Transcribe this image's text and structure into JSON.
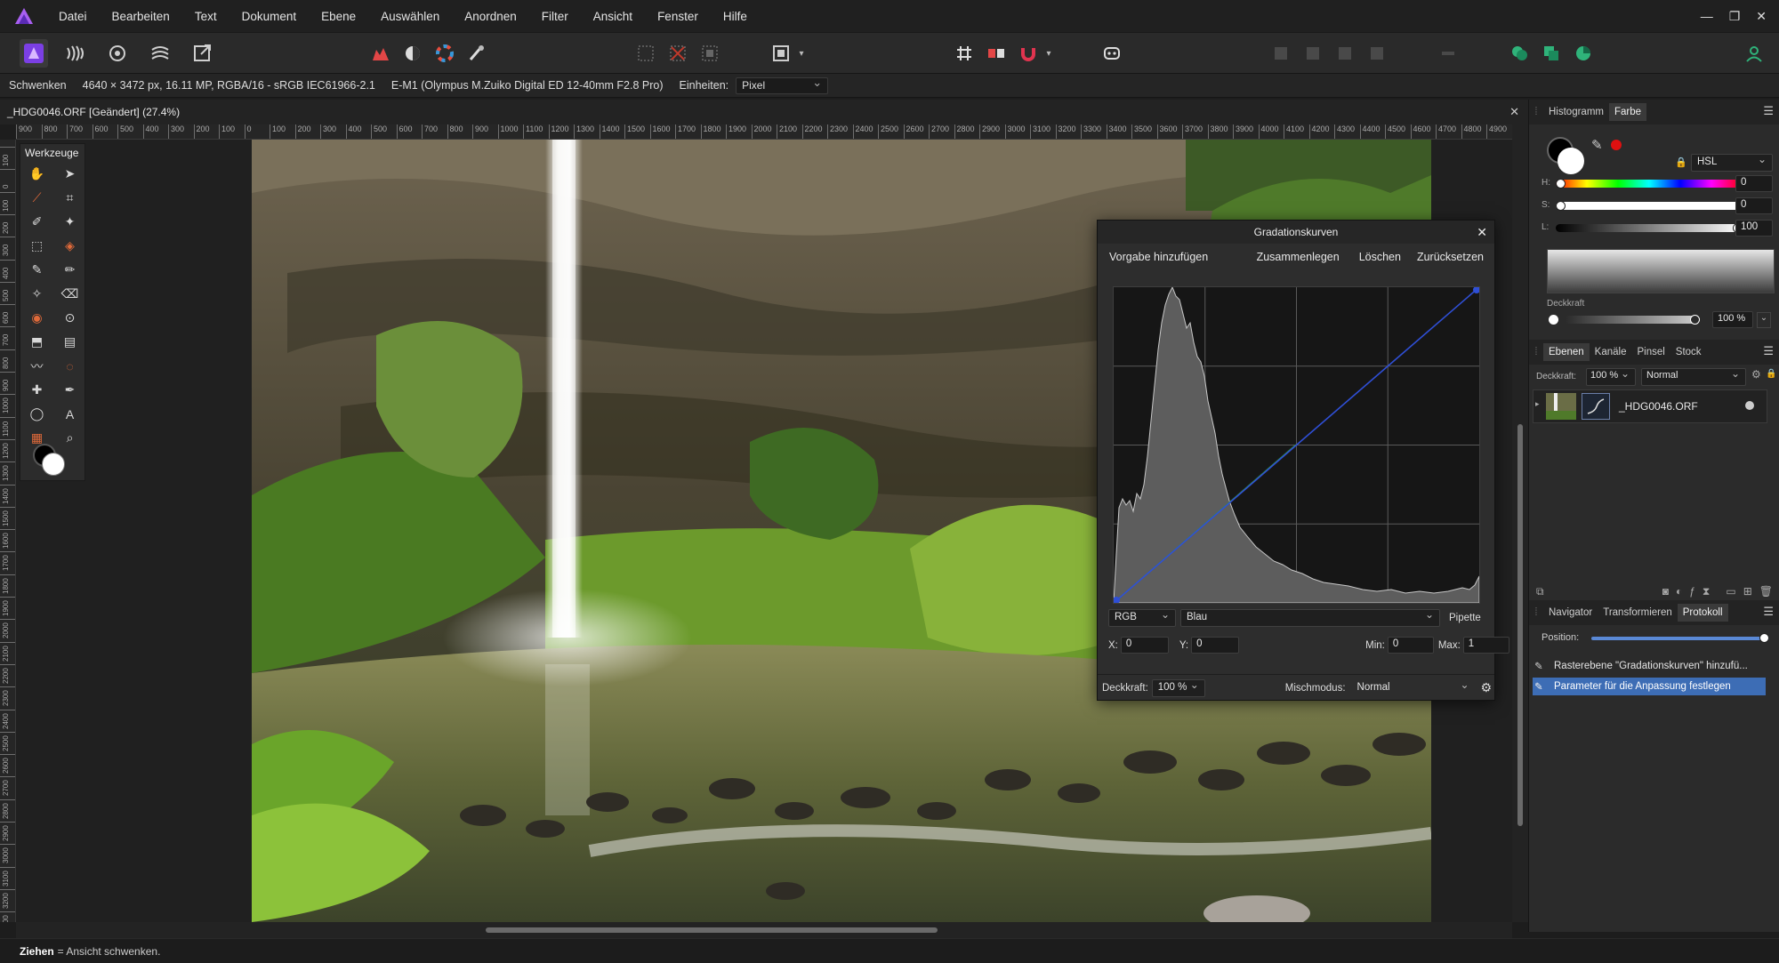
{
  "app": {
    "menu": [
      "Datei",
      "Bearbeiten",
      "Text",
      "Dokument",
      "Ebene",
      "Auswählen",
      "Anordnen",
      "Filter",
      "Ansicht",
      "Fenster",
      "Hilfe"
    ],
    "window_controls": [
      "—",
      "❐",
      "✕"
    ],
    "brand_color": "#7b3fe4"
  },
  "context": {
    "tool": "Schwenken",
    "image_info": "4640 × 3472 px, 16.11 MP, RGBA/16 - sRGB IEC61966-2.1",
    "camera": "E-M1 (Olympus M.Zuiko Digital ED 12-40mm F2.8 Pro)",
    "units_label": "Einheiten:",
    "units_value": "Pixel"
  },
  "document": {
    "tab_title": "_HDG0046.ORF [Geändert] (27.4%)",
    "close": "✕"
  },
  "ruler": {
    "h_labels": [
      "900",
      "800",
      "700",
      "600",
      "500",
      "400",
      "300",
      "200",
      "100",
      "0",
      "100",
      "200",
      "300",
      "400",
      "500",
      "600",
      "700",
      "800",
      "900",
      "1000",
      "1100",
      "1200",
      "1300",
      "1400",
      "1500",
      "1600",
      "1700",
      "1800",
      "1900",
      "2000",
      "2100",
      "2200",
      "2300",
      "2400",
      "2500",
      "2600",
      "2700",
      "2800",
      "2900",
      "3000",
      "3100",
      "3200",
      "3300",
      "3400",
      "3500",
      "3600",
      "3700",
      "3800",
      "3900",
      "4000",
      "4100",
      "4200",
      "4300",
      "4400",
      "4500",
      "4600",
      "4700",
      "4800",
      "4900"
    ],
    "v_labels": [
      "100",
      "0",
      "100",
      "200",
      "300",
      "400",
      "500",
      "600",
      "700",
      "800",
      "900",
      "1000",
      "1100",
      "1200",
      "1300",
      "1400",
      "1500",
      "1600",
      "1700",
      "1800",
      "1900",
      "2000",
      "2100",
      "2200",
      "2300",
      "2400",
      "2500",
      "2600",
      "2700",
      "2800",
      "2900",
      "3000",
      "3100",
      "3200",
      "3300",
      "3400",
      "3500"
    ]
  },
  "tools_panel": {
    "title": "Werkzeuge",
    "icons": [
      "hand-icon",
      "pointer-icon",
      "color-picker-icon",
      "crop-icon",
      "selection-brush-icon",
      "magic-wand-icon",
      "marquee-icon",
      "flood-select-icon",
      "paint-brush-icon",
      "pixel-brush-icon",
      "color-replace-icon",
      "erase-brush-icon",
      "dodge-icon",
      "clone-icon",
      "flood-fill-icon",
      "gradient-icon",
      "smudge-icon",
      "blur-icon",
      "healing-icon",
      "pen-icon",
      "ellipse-icon",
      "text-icon",
      "perspective-icon",
      "zoom-icon"
    ]
  },
  "curves": {
    "title": "Gradationskurven",
    "add_preset": "Vorgabe hinzufügen",
    "merge": "Zusammenlegen",
    "delete": "Löschen",
    "reset": "Zurücksetzen",
    "mode": "RGB",
    "channel": "Blau",
    "picker": "Pipette",
    "x_label": "X:",
    "x_value": "0",
    "y_label": "Y:",
    "y_value": "0",
    "min_label": "Min:",
    "min_value": "0",
    "max_label": "Max:",
    "max_value": "1",
    "opacity_label": "Deckkraft:",
    "opacity_value": "100 %",
    "blend_label": "Mischmodus:",
    "blend_value": "Normal",
    "curve_color": "#2f4fd6",
    "curve_points": [
      [
        0,
        0
      ],
      [
        1,
        1
      ]
    ]
  },
  "color_panel": {
    "tabs": [
      "Histogramm",
      "Farbe"
    ],
    "active_tab": "Farbe",
    "model": "HSL",
    "h_label": "H:",
    "h_value": "0",
    "s_label": "S:",
    "s_value": "0",
    "l_label": "L:",
    "l_value": "100",
    "opacity_label": "Deckkraft",
    "opacity_value": "100 %",
    "opacity_fraction": 1.0,
    "l_fraction": 1.0,
    "h_fraction": 0.0,
    "s_fraction": 0.0,
    "swatch_red": "#e01010"
  },
  "layers_panel": {
    "tabs": [
      "Ebenen",
      "Kanäle",
      "Pinsel",
      "Stock"
    ],
    "active_tab": "Ebenen",
    "opacity_label": "Deckkraft:",
    "opacity_value": "100 %",
    "blend_value": "Normal",
    "layers": [
      {
        "name": "_HDG0046.ORF"
      }
    ]
  },
  "history_panel": {
    "tabs": [
      "Navigator",
      "Transformieren",
      "Protokoll"
    ],
    "active_tab": "Protokoll",
    "position_label": "Position:",
    "position_fraction": 1.0,
    "entries": [
      {
        "label": "Rasterebene \"Gradationskurven\" hinzufü..."
      },
      {
        "label": "Parameter für die Anpassung festlegen"
      }
    ],
    "selected_index": 1,
    "selected_color": "#3d6db5"
  },
  "status": {
    "action": "Ziehen",
    "description": "= Ansicht schwenken."
  }
}
